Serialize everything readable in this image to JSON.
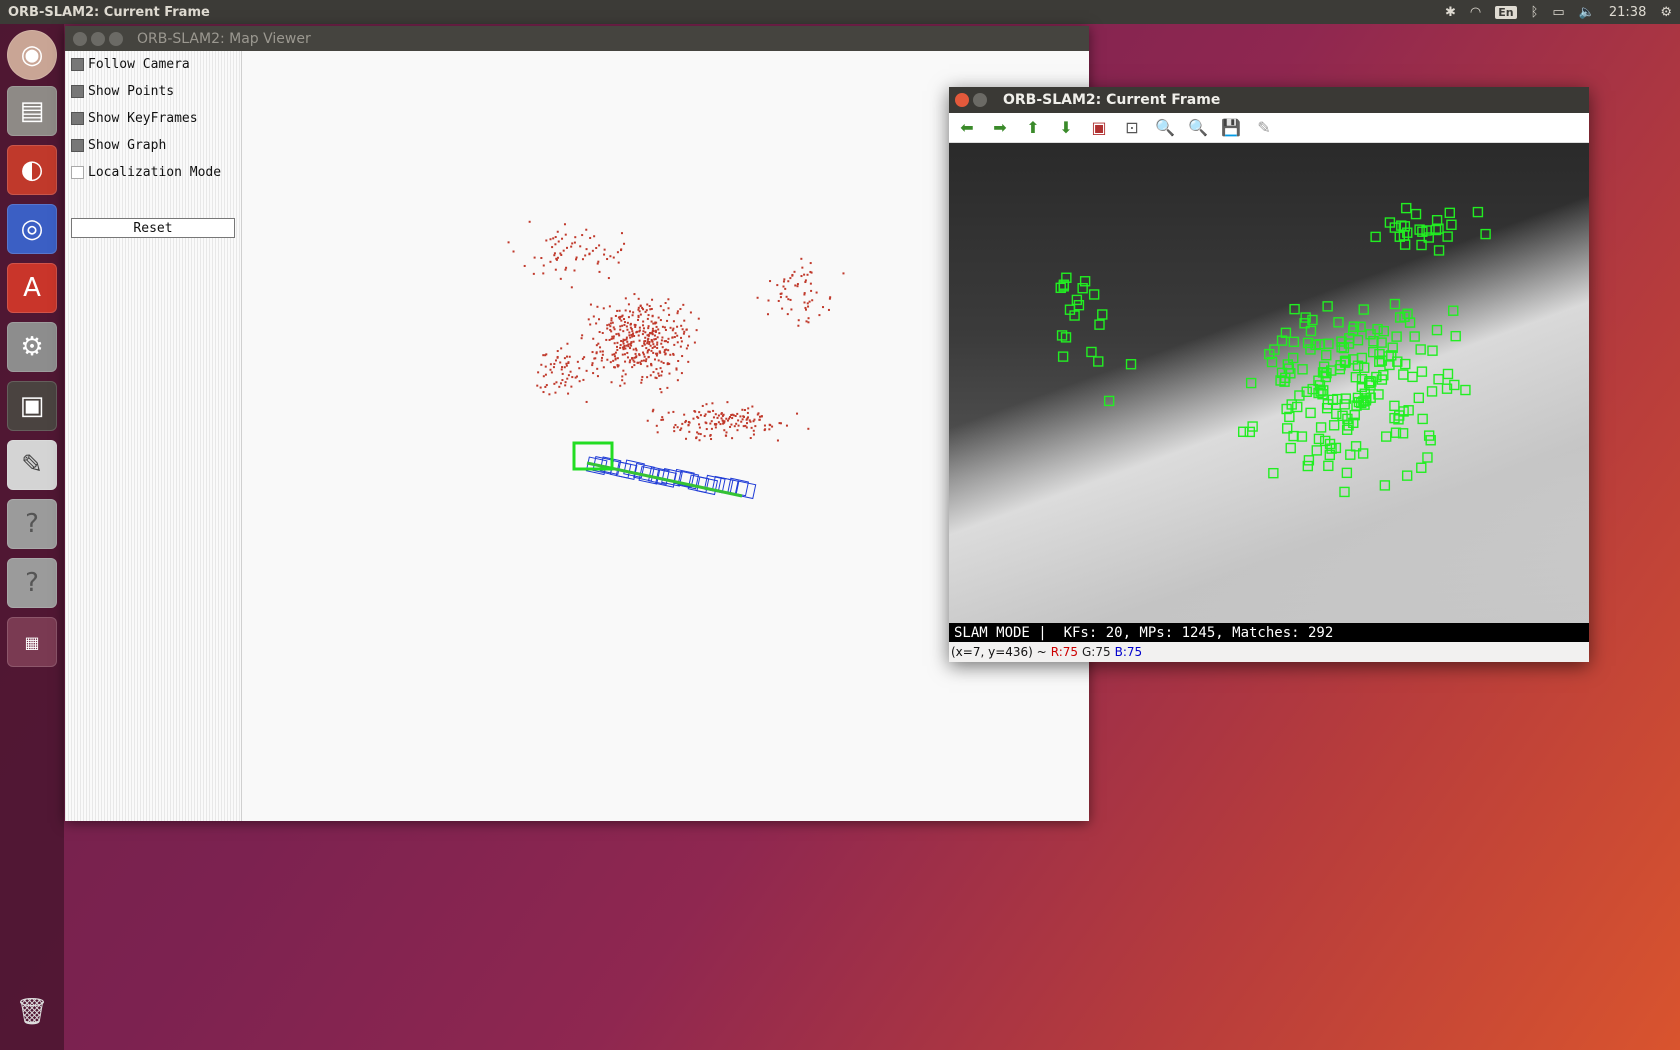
{
  "topbar": {
    "title": "ORB-SLAM2: Current Frame",
    "language": "En",
    "clock": "21:38"
  },
  "launcher": {
    "icons": [
      "ubuntu-dash-icon",
      "files-icon",
      "firefox-icon",
      "chromium-icon",
      "software-center-icon",
      "system-settings-icon",
      "screenshot-icon",
      "text-editor-icon",
      "unknown-app-icon",
      "unknown-app-icon",
      "workspace-switcher-icon",
      "trash-icon"
    ]
  },
  "map_viewer": {
    "title": "ORB-SLAM2: Map Viewer",
    "options": [
      {
        "label": "Follow Camera",
        "checked": true
      },
      {
        "label": "Show Points",
        "checked": true
      },
      {
        "label": "Show KeyFrames",
        "checked": true
      },
      {
        "label": "Show Graph",
        "checked": true
      },
      {
        "label": "Localization Mode",
        "checked": false
      }
    ],
    "reset_label": "Reset",
    "colors": {
      "map_points": "#c0392b",
      "keyframes": "#1f3bd6",
      "current_camera": "#22dd22"
    }
  },
  "current_frame": {
    "title": "ORB-SLAM2: Current Frame",
    "toolbar_icons": [
      "arrow-left-icon",
      "arrow-right-icon",
      "arrow-up-icon",
      "arrow-down-icon",
      "image-icon",
      "zoom-fit-icon",
      "zoom-in-icon",
      "zoom-out-icon",
      "save-icon",
      "properties-icon"
    ],
    "status_text": "SLAM MODE |  KFs: 20, MPs: 1245, Matches: 292",
    "pixel_info": {
      "coords": "(x=7, y=436) ~",
      "r": "R:75",
      "g": "G:75",
      "b": "B:75"
    },
    "colors": {
      "feature_box": "#22ee22"
    }
  }
}
